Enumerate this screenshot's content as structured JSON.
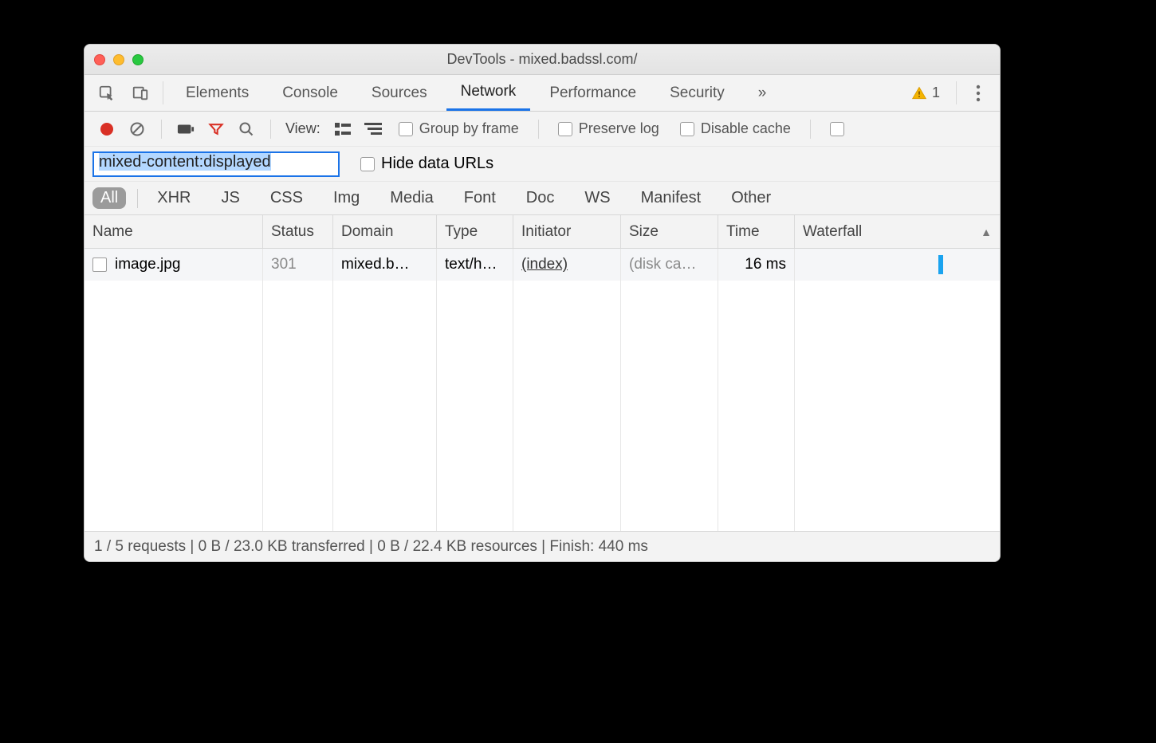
{
  "window": {
    "title": "DevTools - mixed.badssl.com/"
  },
  "tabs": {
    "items": [
      "Elements",
      "Console",
      "Sources",
      "Network",
      "Performance",
      "Security"
    ],
    "active_index": 3,
    "warning_count": "1"
  },
  "toolbar": {
    "view_label": "View:",
    "group_by_frame": "Group by frame",
    "preserve_log": "Preserve log",
    "disable_cache": "Disable cache"
  },
  "filter": {
    "value": "mixed-content:displayed",
    "hide_data_urls": "Hide data URLs"
  },
  "types": [
    "All",
    "XHR",
    "JS",
    "CSS",
    "Img",
    "Media",
    "Font",
    "Doc",
    "WS",
    "Manifest",
    "Other"
  ],
  "types_active_index": 0,
  "columns": [
    "Name",
    "Status",
    "Domain",
    "Type",
    "Initiator",
    "Size",
    "Time",
    "Waterfall"
  ],
  "rows": [
    {
      "name": "image.jpg",
      "status": "301",
      "domain": "mixed.b…",
      "type": "text/h…",
      "initiator": "(index)",
      "size": "(disk ca…",
      "time": "16 ms"
    }
  ],
  "statusbar": "1 / 5 requests | 0 B / 23.0 KB transferred | 0 B / 22.4 KB resources | Finish: 440 ms"
}
